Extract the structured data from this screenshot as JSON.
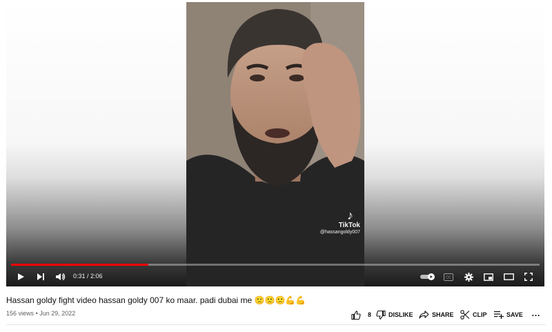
{
  "video": {
    "watermark_brand": "TikTok",
    "watermark_handle": "@hassangoldy007"
  },
  "player": {
    "progress_fraction": 0.26,
    "current_time": "0:31",
    "time_separator": " / ",
    "duration": "2:06",
    "autoplay_on": true,
    "accent_color": "#ff0000"
  },
  "title": "Hassan goldy fight video hassan goldy 007 ko maar. padi dubai me 🙁🙁🙁💪💪",
  "meta": {
    "views": "156 views",
    "separator": " • ",
    "date": "Jun 29, 2022"
  },
  "actions": {
    "like_count": "8",
    "dislike_label": "DISLIKE",
    "share_label": "SHARE",
    "clip_label": "CLIP",
    "save_label": "SAVE",
    "more_label": "…"
  },
  "icons": [
    "play-icon",
    "next-icon",
    "volume-icon",
    "autoplay-toggle-icon",
    "subtitles-icon",
    "settings-icon",
    "miniplayer-icon",
    "theater-icon",
    "fullscreen-icon",
    "like-icon",
    "dislike-icon",
    "share-icon",
    "clip-icon",
    "save-icon",
    "more-icon"
  ]
}
